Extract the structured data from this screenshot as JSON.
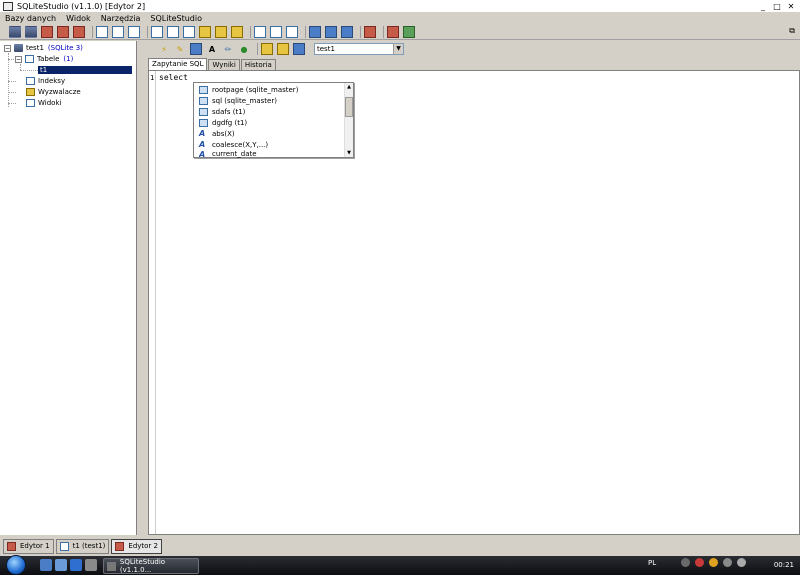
{
  "window": {
    "title": "SQLiteStudio (v1.1.0) [Edytor 2]",
    "controls": [
      "_",
      "□",
      "✕"
    ]
  },
  "menu": [
    "Bazy danych",
    "Widok",
    "Narzędzia",
    "SQLiteStudio"
  ],
  "tree": {
    "db_name": "test1",
    "db_type": "(SQLite 3)",
    "tables_label": "Tabele",
    "tables_count": "(1)",
    "table_item": "t1",
    "indexes_label": "Indeksy",
    "triggers_label": "Wyzwalacze",
    "views_label": "Widoki"
  },
  "editor": {
    "db_selected": "test1",
    "tabs": [
      "Zapytanie SQL",
      "Wyniki",
      "Historia"
    ],
    "line_number": "1",
    "code": "select"
  },
  "autocomplete": {
    "items": [
      {
        "label": "rootpage (sqlite_master)",
        "icon": "column-icon"
      },
      {
        "label": "sql (sqlite_master)",
        "icon": "column-icon"
      },
      {
        "label": "sdafs (t1)",
        "icon": "column-icon"
      },
      {
        "label": "dgdfg (t1)",
        "icon": "column-icon"
      },
      {
        "label": "abs(X)",
        "icon": "function-icon"
      },
      {
        "label": "coalesce(X,Y,...)",
        "icon": "function-icon"
      },
      {
        "label": "current_date",
        "icon": "function-icon"
      }
    ]
  },
  "window_tabs": [
    "Edytor 1",
    "t1 (test1)",
    "Edytor 2"
  ],
  "taskbar": {
    "task_label": "SQLiteStudio (v1.1.0...",
    "language": "PL",
    "clock": "00:21"
  }
}
